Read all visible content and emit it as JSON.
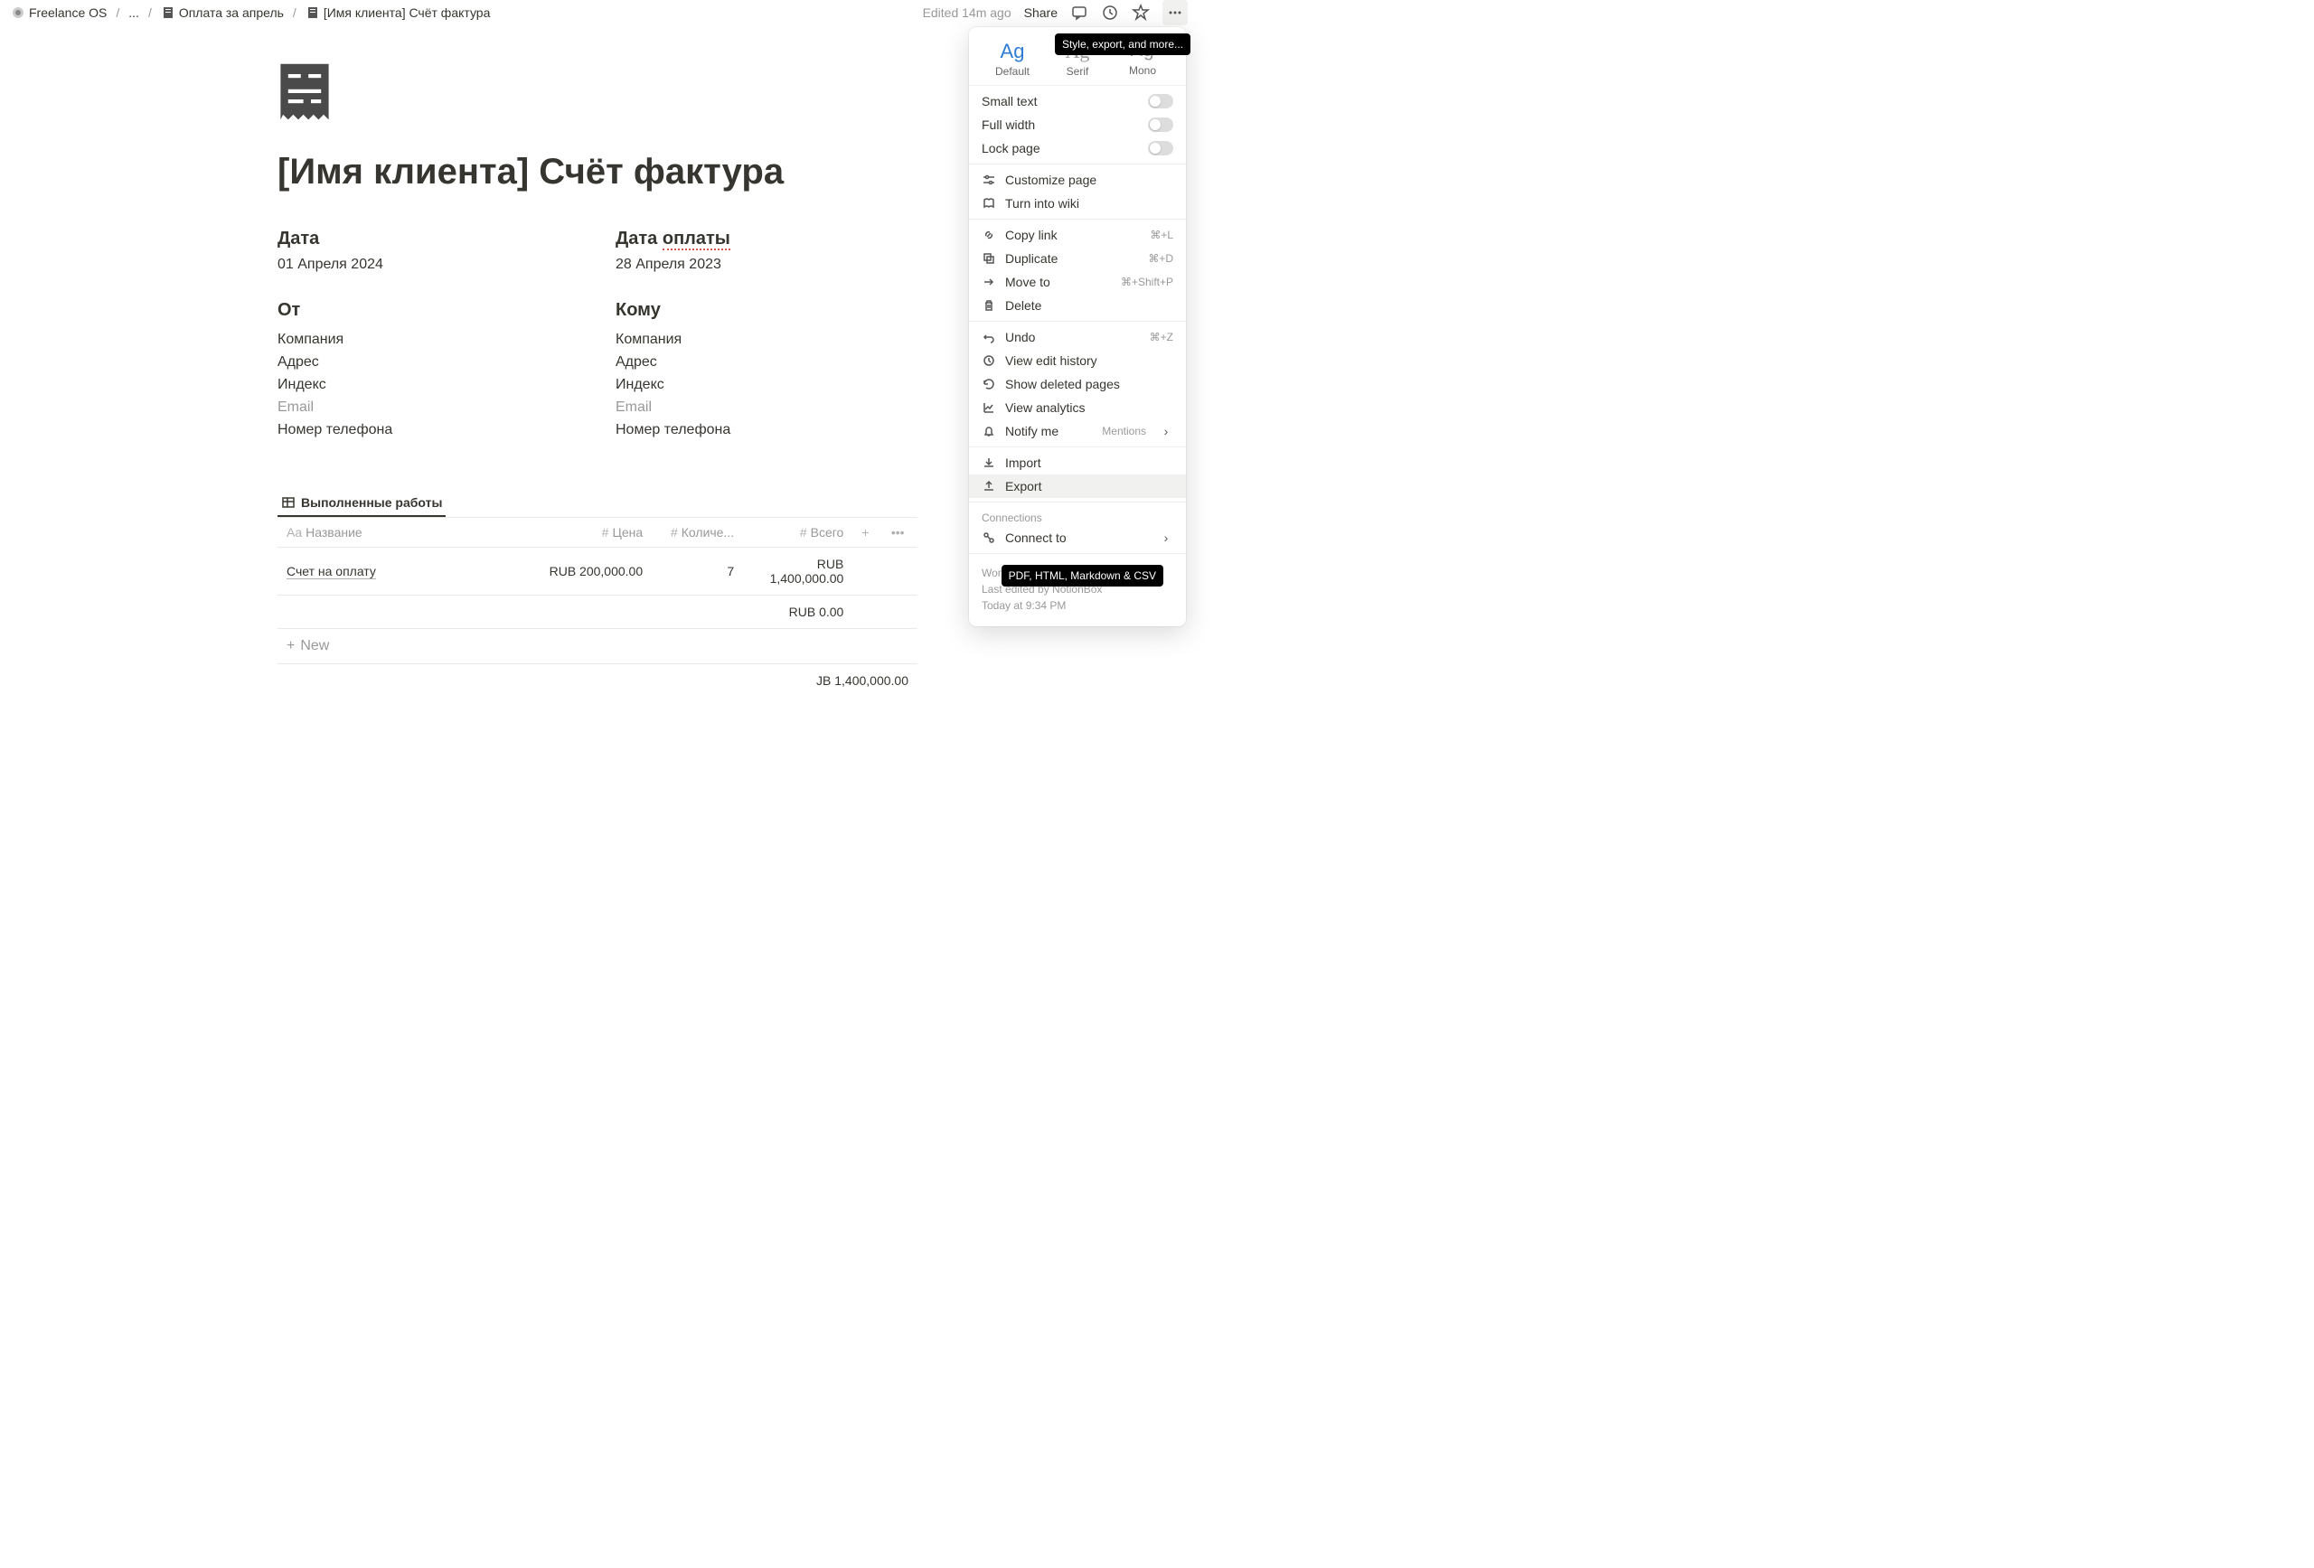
{
  "breadcrumbs": {
    "root": "Freelance OS",
    "mid": "...",
    "parent": "Оплата за апрель",
    "current": "[Имя клиента] Счёт фактура"
  },
  "topbar": {
    "edited": "Edited 14m ago",
    "share": "Share"
  },
  "tooltip_more": "Style, export, and more...",
  "tooltip_export": "PDF, HTML, Markdown & CSV",
  "page": {
    "title": "[Имя клиента] Счёт фактура",
    "date_label": "Дата",
    "date_value": "01 Апреля 2024",
    "paydate_label_prefix": "Дата ",
    "paydate_label_word": "оплаты",
    "paydate_value": "28 Апреля 2023",
    "from_label": "От",
    "to_label": "Кому",
    "info_company": "Компания",
    "info_address": "Адрес",
    "info_index": "Индекс",
    "info_email": "Email",
    "info_phone": "Номер телефона"
  },
  "db": {
    "tab": "Выполненные работы",
    "col_name": "Название",
    "col_price": "Цена",
    "col_qty": "Количе...",
    "col_total": "Всего",
    "row1_name": "Счет на оплату",
    "row1_price": "RUB 200,000.00",
    "row1_qty": "7",
    "row1_total": "RUB 1,400,000.00",
    "row2_total": "RUB 0.00",
    "new": "New",
    "sum": "JB 1,400,000.00"
  },
  "menu": {
    "font_default": "Default",
    "font_serif": "Serif",
    "font_mono": "Mono",
    "ag": "Ag",
    "small_text": "Small text",
    "full_width": "Full width",
    "lock_page": "Lock page",
    "customize": "Customize page",
    "turn_wiki": "Turn into wiki",
    "copy_link": "Copy link",
    "copy_link_sc": "⌘+L",
    "duplicate": "Duplicate",
    "duplicate_sc": "⌘+D",
    "move_to": "Move to",
    "move_to_sc": "⌘+Shift+P",
    "delete": "Delete",
    "undo": "Undo",
    "undo_sc": "⌘+Z",
    "history": "View edit history",
    "deleted": "Show deleted pages",
    "analytics": "View analytics",
    "notify": "Notify me",
    "notify_val": "Mentions",
    "import": "Import",
    "export": "Export",
    "connections": "Connections",
    "connect_to": "Connect to",
    "footer1": "Word count: 30",
    "footer2": "Last edited by NotionBox",
    "footer3": "Today at 9:34 PM"
  }
}
